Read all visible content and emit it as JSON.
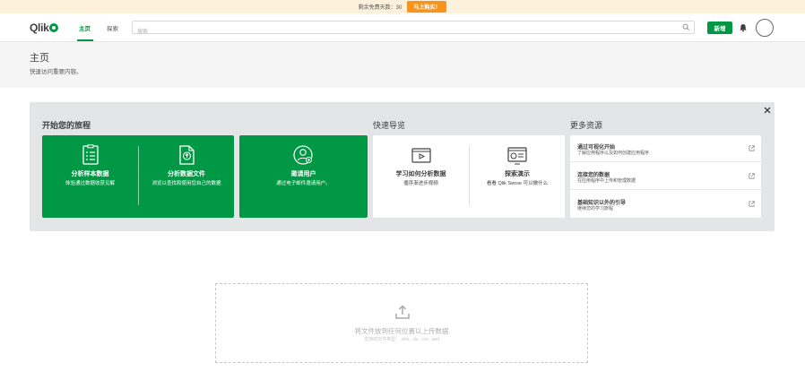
{
  "trial": {
    "text": "剩余免费天数：30",
    "button": "马上购买！"
  },
  "nav": {
    "logo": "Qlik",
    "tabs": [
      "主页",
      "探索"
    ],
    "search_placeholder": "搜索",
    "new_button": "新增"
  },
  "header": {
    "title": "主页",
    "subtitle": "快速访问重要内容。"
  },
  "getting_started": {
    "section_titles": {
      "journey": "开始您的旅程",
      "quick_nav": "快速导览",
      "more_resources": "更多资源"
    },
    "journey_cards": [
      {
        "title": "分析样本数据",
        "desc": "体验通过数据收获见解",
        "icon": "clipboard-list-icon"
      },
      {
        "title": "分析数据文件",
        "desc": "浏览以查找和使用您自己的数据",
        "icon": "upload-file-icon"
      },
      {
        "title": "邀请用户",
        "desc": "通过电子邮件邀请用户。",
        "icon": "invite-user-icon"
      }
    ],
    "quick_nav_cards": [
      {
        "title": "学习如何分析数据",
        "desc": "循序渐进步视频",
        "icon": "video-play-icon"
      },
      {
        "title": "探索演示",
        "desc": "看看 Qlik Sense 可以做什么",
        "icon": "demo-chart-icon"
      }
    ],
    "resources": [
      {
        "title": "通过可视化开始",
        "desc": "了解应用程序以及如何创建应用程序"
      },
      {
        "title": "连接您的数据",
        "desc": "在应用程序中上传和管理数据"
      },
      {
        "title": "基础知识以外的引导",
        "desc": "继续您的学习旅程"
      }
    ]
  },
  "upload": {
    "title": "将文件放到任何位置以上传数据",
    "formats": "支持的文件类型：.xlsx, .xls, .csv, .qvd"
  },
  "colors": {
    "brand_green": "#009845",
    "trial_orange": "#f7941d",
    "trial_banner_bg": "#fdf1dc"
  }
}
